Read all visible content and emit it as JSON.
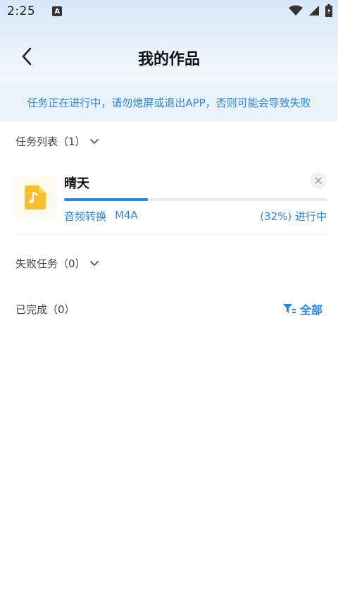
{
  "status_bar": {
    "time": "2:25",
    "indicator": "A"
  },
  "header": {
    "title": "我的作品",
    "back_icon": "chevron-left-icon"
  },
  "notice": {
    "text": "任务正在进行中，请勿熄屏或退出APP，否则可能会导致失败"
  },
  "sections": {
    "task_list": {
      "label": "任务列表（1）"
    },
    "failed": {
      "label": "失败任务（0）"
    },
    "completed": {
      "label": "已完成（0）"
    }
  },
  "task": {
    "name": "晴天",
    "category": "音频转换",
    "format": "M4A",
    "progress": 0.32,
    "progress_text": "(32%) 进行中",
    "thumb_icon": "music-note-icon"
  },
  "filter": {
    "label": "全部",
    "icon": "filter-icon"
  },
  "colors": {
    "accent": "#2b86d9",
    "notice_bg": "#eaf3fc",
    "thumb": "#f6c02c"
  }
}
